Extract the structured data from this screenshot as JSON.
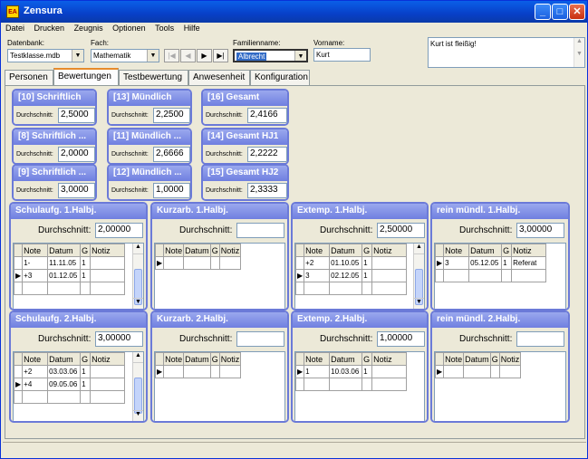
{
  "window": {
    "title": "Zensura",
    "icon_text": "EA"
  },
  "menu": [
    "Datei",
    "Drucken",
    "Zeugnis",
    "Optionen",
    "Tools",
    "Hilfe"
  ],
  "toolbar": {
    "datenbank_label": "Datenbank:",
    "datenbank_value": "Testklasse.mdb",
    "fach_label": "Fach:",
    "fach_value": "Mathematik",
    "familienname_label": "Familienname:",
    "familienname_value": "Albrecht",
    "vorname_label": "Vorname:",
    "vorname_value": "Kurt",
    "memo_text": "Kurt ist fleißig!"
  },
  "nav_buttons": [
    "|◀",
    "◀",
    "▶",
    "▶|"
  ],
  "tabs": [
    "Personen",
    "Bewertungen",
    "Testbewertung",
    "Anwesenheit",
    "Konfiguration"
  ],
  "avg_label": "Durchschnitt:",
  "small_boxes": [
    {
      "title": "[10] Schriftlich",
      "value": "2,5000"
    },
    {
      "title": "[13] Mündlich",
      "value": "2,2500"
    },
    {
      "title": "[16] Gesamt",
      "value": "2,4166"
    },
    {
      "title": "[8] Schriftlich ...",
      "value": "2,0000"
    },
    {
      "title": "[11] Mündlich ...",
      "value": "2,6666"
    },
    {
      "title": "[14] Gesamt HJ1",
      "value": "2,2222"
    },
    {
      "title": "[9] Schriftlich ...",
      "value": "3,0000"
    },
    {
      "title": "[12] Mündlich ...",
      "value": "1,0000"
    },
    {
      "title": "[15] Gesamt HJ2",
      "value": "2,3333"
    }
  ],
  "grid_headers": [
    "Note",
    "Datum",
    "G",
    "Notiz"
  ],
  "big_boxes": [
    {
      "title": "Schulaufg. 1.Halbj.",
      "avg": "2,00000",
      "rows": [
        {
          "note": "1-",
          "datum": "11.11.05",
          "g": "1",
          "notiz": ""
        },
        {
          "note": "+3",
          "datum": "01.12.05",
          "g": "1",
          "notiz": ""
        }
      ]
    },
    {
      "title": "Kurzarb. 1.Halbj.",
      "avg": "",
      "rows": []
    },
    {
      "title": "Extemp. 1.Halbj.",
      "avg": "2,50000",
      "rows": [
        {
          "note": "+2",
          "datum": "01.10.05",
          "g": "1",
          "notiz": ""
        },
        {
          "note": "3",
          "datum": "02.12.05",
          "g": "1",
          "notiz": ""
        }
      ]
    },
    {
      "title": "rein mündl. 1.Halbj.",
      "avg": "3,00000",
      "rows": [
        {
          "note": "3",
          "datum": "05.12.05",
          "g": "1",
          "notiz": "Referat"
        }
      ]
    },
    {
      "title": "Schulaufg. 2.Halbj.",
      "avg": "3,00000",
      "rows": [
        {
          "note": "+2",
          "datum": "03.03.06",
          "g": "1",
          "notiz": ""
        },
        {
          "note": "+4",
          "datum": "09.05.06",
          "g": "1",
          "notiz": ""
        }
      ]
    },
    {
      "title": "Kurzarb. 2.Halbj.",
      "avg": "",
      "rows": []
    },
    {
      "title": "Extemp. 2.Halbj.",
      "avg": "1,00000",
      "rows": [
        {
          "note": "1",
          "datum": "10.03.06",
          "g": "1",
          "notiz": ""
        }
      ]
    },
    {
      "title": "rein mündl. 2.Halbj.",
      "avg": "",
      "rows": []
    }
  ],
  "colors": {
    "accent": "#6f7fe0",
    "titlebar": "#0a5fe8"
  }
}
